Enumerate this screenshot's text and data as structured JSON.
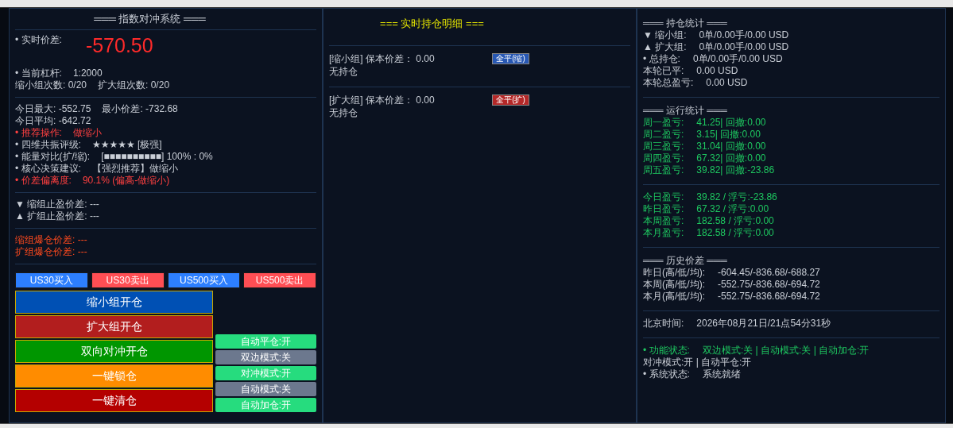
{
  "left": {
    "title": "═══ 指数对冲系统 ═══",
    "price": {
      "label": "• 实时价差:",
      "value": "-570.50"
    },
    "lines_a": [
      {
        "label": "• 当前杠杆:",
        "value": "1:2000",
        "kind": "plain"
      },
      {
        "label": "缩小组次数: 0/20",
        "value": "扩大组次数: 0/20",
        "kind": "plain"
      }
    ],
    "lines_b": [
      {
        "label": "今日最大: -552.75",
        "value": "最小价差: -732.68",
        "kind": "plain"
      },
      {
        "label": "今日平均: -642.72",
        "kind": "plain"
      },
      {
        "label": "• 推荐操作:",
        "value": "做缩小",
        "kind": "alert"
      },
      {
        "label": "• 四维共振评级:",
        "value": "★★★★★ [极强]",
        "kind": "plain"
      },
      {
        "label": "• 能量对比(扩/缩):",
        "value": "[■■■■■■■■■■] 100% : 0%",
        "kind": "plain"
      },
      {
        "label": "• 核心决策建议:",
        "value": "【强烈推荐】做缩小",
        "kind": "plain"
      },
      {
        "label": "• 价差偏离度:",
        "value": "90.1% (偏高-做缩小)",
        "kind": "alert"
      }
    ],
    "lines_c": [
      {
        "label": "▼ 缩组止盈价差: ---",
        "kind": "plain"
      },
      {
        "label": "▲ 扩组止盈价差: ---",
        "kind": "plain"
      }
    ],
    "lines_d": [
      {
        "label": "缩组爆仓价差: ---",
        "kind": "warning"
      },
      {
        "label": "扩组爆仓价差: ---",
        "kind": "warning"
      }
    ],
    "trade_buttons": [
      {
        "label": "US30买入",
        "kind": "buy"
      },
      {
        "label": "US30卖出",
        "kind": "sell"
      },
      {
        "label": "US500买入",
        "kind": "buy"
      },
      {
        "label": "US500卖出",
        "kind": "sell"
      }
    ],
    "action_buttons": [
      {
        "label": "缩小组开仓",
        "color": "#0050b4"
      },
      {
        "label": "扩大组开仓",
        "color": "#b21e1e"
      },
      {
        "label": "双向对冲开仓",
        "color": "#009600"
      },
      {
        "label": "一键锁仓",
        "color": "#ff8c00"
      },
      {
        "label": "一键清仓",
        "color": "#b40000"
      }
    ],
    "toggles": [
      {
        "label": "自动平仓:开",
        "on": true
      },
      {
        "label": "双边模式:关",
        "on": false
      },
      {
        "label": "对冲模式:开",
        "on": true
      },
      {
        "label": "自动模式:关",
        "on": false
      },
      {
        "label": "自动加仓:开",
        "on": true
      }
    ]
  },
  "middle": {
    "title": "=== 实时持仓明细 ===",
    "groups": [
      {
        "header": "[缩小组] 保本价差： 0.00",
        "status": "无持仓",
        "button": {
          "label": "全平(缩)",
          "kind": "buy"
        }
      },
      {
        "header": "[扩大组] 保本价差： 0.00",
        "status": "无持仓",
        "button": {
          "label": "全平(扩)",
          "kind": "sell"
        }
      }
    ]
  },
  "right": {
    "sections": [
      {
        "title": "═══ 持仓统计 ═══",
        "lines": [
          {
            "label": "▼ 缩小组:",
            "value": "0单/0.00手/0.00 USD",
            "kind": "plain"
          },
          {
            "label": "▲ 扩大组:",
            "value": "0单/0.00手/0.00 USD",
            "kind": "plain"
          },
          {
            "label": "• 总持仓:",
            "value": "0单/0.00手/0.00 USD",
            "kind": "plain"
          },
          {
            "label": "本轮已平:",
            "value": "0.00 USD",
            "kind": "plain"
          },
          {
            "label": "本轮总盈亏:",
            "value": "0.00 USD",
            "kind": "plain"
          }
        ]
      },
      {
        "title": "═══ 运行统计 ═══",
        "lines": [
          {
            "label": "周一盈亏:",
            "value": "41.25| 回撤:0.00",
            "kind": "profit"
          },
          {
            "label": "周二盈亏:",
            "value": "3.15| 回撤:0.00",
            "kind": "profit"
          },
          {
            "label": "周三盈亏:",
            "value": "31.04| 回撤:0.00",
            "kind": "profit"
          },
          {
            "label": "周四盈亏:",
            "value": "67.32| 回撤:0.00",
            "kind": "profit"
          },
          {
            "label": "周五盈亏:",
            "value": "39.82| 回撤:-23.86",
            "kind": "profit"
          }
        ]
      },
      {
        "lines": [
          {
            "label": "今日盈亏:",
            "value": "39.82 / 浮亏:-23.86",
            "kind": "profit"
          },
          {
            "label": "昨日盈亏:",
            "value": "67.32 / 浮亏:0.00",
            "kind": "profit"
          },
          {
            "label": "本周盈亏:",
            "value": "182.58 / 浮亏:0.00",
            "kind": "profit"
          },
          {
            "label": "本月盈亏:",
            "value": "182.58 / 浮亏:0.00",
            "kind": "profit"
          }
        ]
      },
      {
        "title": "═══ 历史价差 ═══",
        "lines": [
          {
            "label": "昨日(高/低/均):",
            "value": "-604.45/-836.68/-688.27",
            "kind": "plain"
          },
          {
            "label": "本周(高/低/均):",
            "value": "-552.75/-836.68/-694.72",
            "kind": "plain"
          },
          {
            "label": "本月(高/低/均):",
            "value": "-552.75/-836.68/-694.72",
            "kind": "plain"
          }
        ]
      },
      {
        "lines": [
          {
            "label": "北京时间:",
            "value": "2026年08月21日/21点54分31秒",
            "kind": "plain"
          }
        ]
      },
      {
        "lines": [
          {
            "label": "• 功能状态:",
            "value": "双边模式:关 | 自动模式:关 | 自动加仓:开",
            "kind": "profit"
          },
          {
            "label": "对冲模式:开 | 自动平仓:开",
            "kind": "plain"
          },
          {
            "label": "• 系统状态:",
            "value": "系统就绪",
            "kind": "plain"
          }
        ]
      }
    ]
  }
}
